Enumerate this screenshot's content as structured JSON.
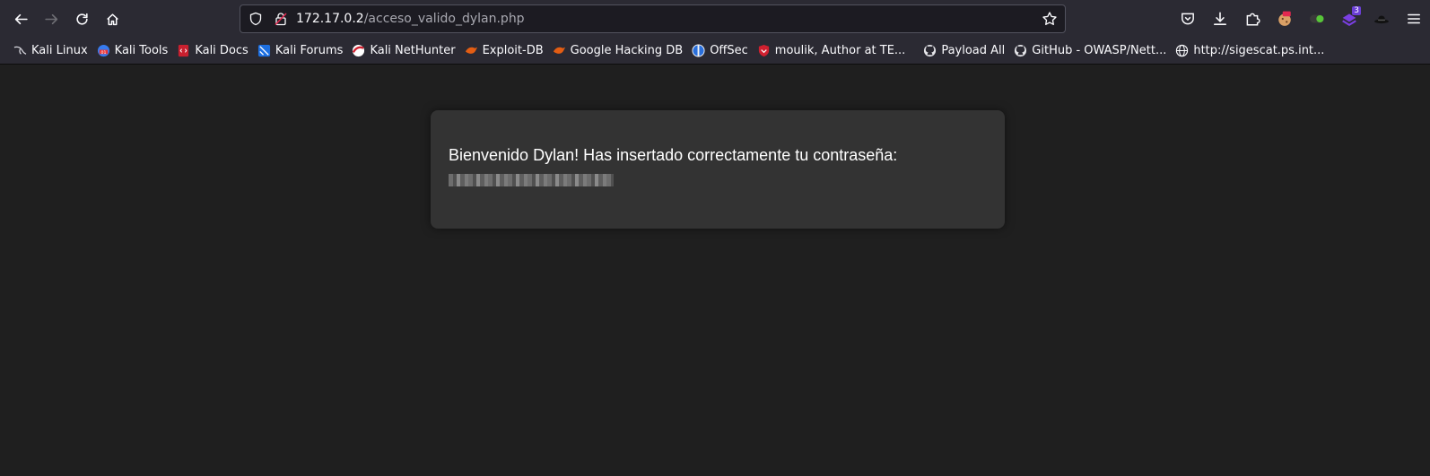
{
  "browser": {
    "url_host": "172.17.0.2",
    "url_path": "/acceso_valido_dylan.php",
    "extension_badge": "3",
    "colors": {
      "toolbar": "#2b2a33",
      "urlbar": "#1c1b22",
      "page_bg": "#1f1f1f",
      "card_bg": "#333333"
    }
  },
  "bookmarks": [
    {
      "label": "Kali Linux",
      "icon": "kali-dragon-icon"
    },
    {
      "label": "Kali Tools",
      "icon": "kali-tools-icon"
    },
    {
      "label": "Kali Docs",
      "icon": "kali-docs-icon"
    },
    {
      "label": "Kali Forums",
      "icon": "kali-forums-icon"
    },
    {
      "label": "Kali NetHunter",
      "icon": "kali-nethunter-icon"
    },
    {
      "label": "Exploit-DB",
      "icon": "exploit-db-icon"
    },
    {
      "label": "Google Hacking DB",
      "icon": "ghdb-icon"
    },
    {
      "label": "OffSec",
      "icon": "offsec-icon"
    },
    {
      "label": "moulik, Author at TE...",
      "icon": "shield-red-icon"
    },
    {
      "label": "Payload All",
      "icon": "github-icon"
    },
    {
      "label": "GitHub - OWASP/Nett...",
      "icon": "github-icon"
    },
    {
      "label": "http://sigescat.ps.int...",
      "icon": "globe-icon"
    }
  ],
  "page": {
    "message": "Bienvenido Dylan! Has insertado correctamente tu contraseña:"
  }
}
